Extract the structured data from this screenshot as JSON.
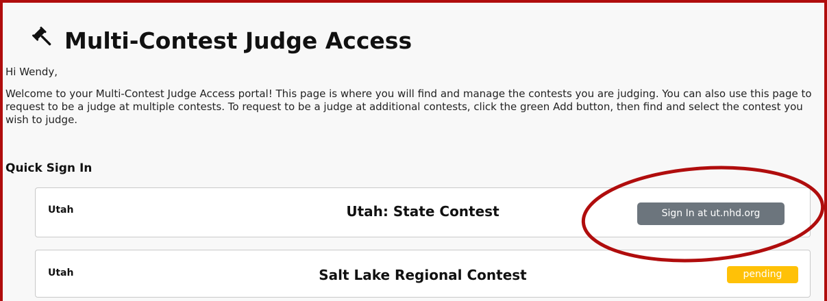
{
  "header": {
    "title": "Multi-Contest Judge Access",
    "icon": "gavel-icon"
  },
  "greeting": "Hi Wendy,",
  "intro": "Welcome to your Multi-Contest Judge Access portal! This page is where you will find and manage the contests you are judging. You can also use this page to request to be a judge at multiple contests. To request to be a judge at additional contests, click the green Add button, then find and select the contest you wish to judge.",
  "quick_sign_in": {
    "heading": "Quick Sign In",
    "contests": [
      {
        "state": "Utah",
        "name": "Utah: State Contest",
        "action_label": "Sign In at ut.nhd.org"
      },
      {
        "state": "Utah",
        "name": "Salt Lake Regional Contest",
        "status": "pending"
      }
    ]
  },
  "colors": {
    "frame_border": "#b00d0d",
    "annotation_circle": "#b00d0d",
    "sign_in_button": "#6c757d",
    "pending_badge": "#ffc107"
  }
}
